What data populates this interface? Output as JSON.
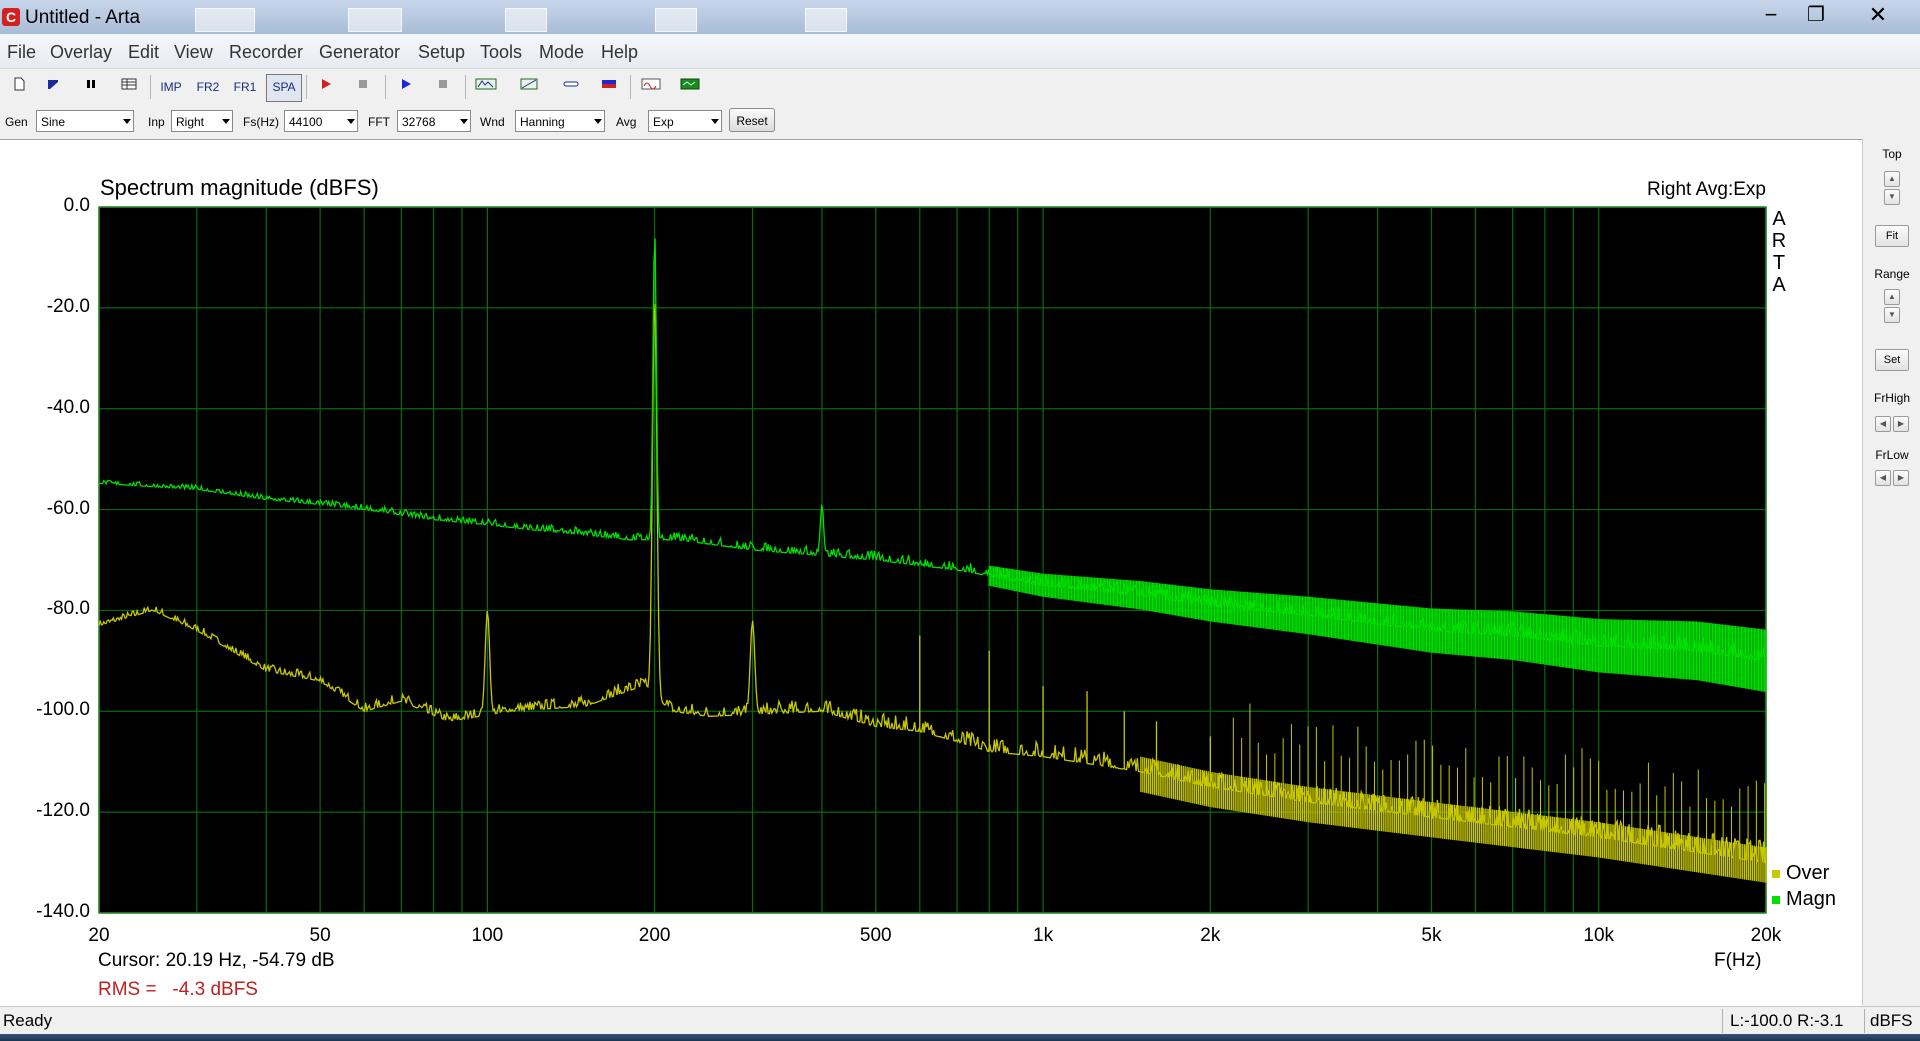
{
  "window": {
    "app_icon_letter": "C",
    "title": "Untitled - Arta",
    "controls": {
      "minimize": "−",
      "maximize": "❐",
      "close": "✕"
    }
  },
  "menu": [
    "File",
    "Overlay",
    "Edit",
    "View",
    "Recorder",
    "Generator",
    "Setup",
    "Tools",
    "Mode",
    "Help"
  ],
  "toolbar": {
    "imp": "IMP",
    "fr2": "FR2",
    "fr1": "FR1",
    "spa": "SPA"
  },
  "controls": {
    "gen_label": "Gen",
    "gen_value": "Sine",
    "inp_label": "Inp",
    "inp_value": "Right",
    "fs_label": "Fs(Hz)",
    "fs_value": "44100",
    "fft_label": "FFT",
    "fft_value": "32768",
    "wnd_label": "Wnd",
    "wnd_value": "Hanning",
    "avg_label": "Avg",
    "avg_value": "Exp",
    "reset_label": "Reset"
  },
  "plot": {
    "title": "Spectrum magnitude (dBFS)",
    "status": "Right Avg:Exp",
    "brand_vertical": [
      "A",
      "R",
      "T",
      "A"
    ],
    "cursor": "Cursor: 20.19 Hz, -54.79 dB",
    "rms": "RMS =   -4.3 dBFS",
    "x_unit": "F(Hz)",
    "legend": [
      {
        "name": "Over",
        "color": "#c8c800"
      },
      {
        "name": "Magn",
        "color": "#00e000"
      }
    ]
  },
  "chart_data": {
    "type": "line",
    "title": "Spectrum magnitude (dBFS)",
    "xlabel": "F(Hz)",
    "ylabel": "",
    "x_scale": "log",
    "xlim": [
      20,
      20000
    ],
    "ylim": [
      -140,
      0
    ],
    "x_ticks": [
      {
        "label": "20",
        "value": 20
      },
      {
        "label": "50",
        "value": 50
      },
      {
        "label": "100",
        "value": 100
      },
      {
        "label": "200",
        "value": 200
      },
      {
        "label": "500",
        "value": 500
      },
      {
        "label": "1k",
        "value": 1000
      },
      {
        "label": "2k",
        "value": 2000
      },
      {
        "label": "5k",
        "value": 5000
      },
      {
        "label": "10k",
        "value": 10000
      },
      {
        "label": "20k",
        "value": 20000
      }
    ],
    "y_ticks": [
      "0.0",
      "-20.0",
      "-40.0",
      "-60.0",
      "-80.0",
      "-100.0",
      "-120.0",
      "-140.0"
    ],
    "grid": true,
    "background": "#000000",
    "grid_color": "#0a6a0a",
    "legend_position": "bottom-right",
    "series": [
      {
        "name": "Magn",
        "color": "#00e000",
        "x": [
          20,
          30,
          40,
          50,
          60,
          80,
          100,
          120,
          150,
          180,
          200,
          220,
          300,
          400,
          500,
          700,
          1000,
          1500,
          2000,
          3000,
          5000,
          7000,
          10000,
          15000,
          20000
        ],
        "y": [
          -54.8,
          -56,
          -58,
          -59,
          -60,
          -62,
          -63,
          -64,
          -65,
          -66,
          -4.5,
          -66,
          -68,
          -59,
          -70,
          -72,
          -75,
          -77,
          -79,
          -81,
          -84,
          -85,
          -87,
          -88,
          -90
        ]
      },
      {
        "name": "Over",
        "color": "#c8c800",
        "x": [
          20,
          25,
          30,
          40,
          50,
          60,
          70,
          85,
          100,
          110,
          150,
          190,
          200,
          215,
          250,
          300,
          400,
          500,
          600,
          700,
          800,
          1000,
          1500,
          2000,
          3000,
          5000,
          10000,
          20000
        ],
        "y": [
          -83,
          -80,
          -84,
          -92,
          -94,
          -100,
          -98,
          -102,
          -80,
          -100,
          -99,
          -95,
          -18,
          -100,
          -101,
          -82,
          -100,
          -103,
          -104,
          -106,
          -108,
          -109,
          -112,
          -115,
          -118,
          -121,
          -125,
          -130
        ]
      }
    ],
    "harmonic_spikes_hz": [
      300,
      400,
      600,
      800,
      1000,
      1200,
      1400,
      1600,
      2000
    ]
  },
  "right_panel": {
    "top_label": "Top",
    "fit_label": "Fit",
    "range_label": "Range",
    "set_label": "Set",
    "frhigh_label": "FrHigh",
    "frlow_label": "FrLow"
  },
  "status": {
    "ready": "Ready",
    "levels": "L:-100.0 R:-3.1",
    "unit": "dBFS"
  }
}
